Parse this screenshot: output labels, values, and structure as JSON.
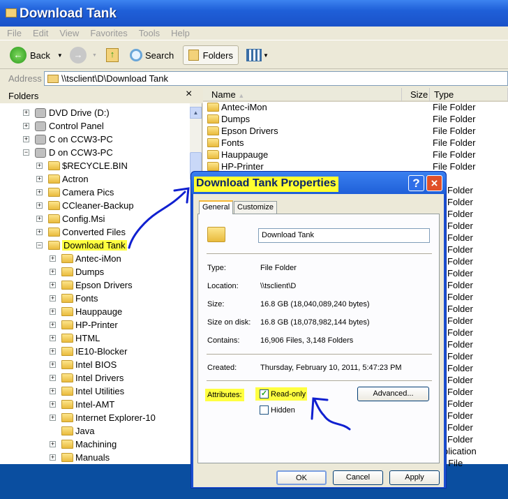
{
  "window": {
    "title": "Download Tank"
  },
  "menu": [
    "File",
    "Edit",
    "View",
    "Favorites",
    "Tools",
    "Help"
  ],
  "toolbar": {
    "back": "Back",
    "search": "Search",
    "folders": "Folders"
  },
  "address": {
    "label": "Address",
    "value": "\\\\tsclient\\D\\Download Tank"
  },
  "folders_pane": {
    "title": "Folders",
    "close": "×"
  },
  "tree": [
    {
      "label": "DVD Drive (D:)",
      "level": 0,
      "icon": "dvd-drive-icon",
      "exp": "+"
    },
    {
      "label": "Control Panel",
      "level": 0,
      "icon": "control-panel-icon",
      "exp": "+"
    },
    {
      "label": "C on CCW3-PC",
      "level": 0,
      "icon": "network-drive-icon",
      "exp": "+"
    },
    {
      "label": "D on CCW3-PC",
      "level": 0,
      "icon": "network-drive-icon",
      "exp": "−"
    },
    {
      "label": "$RECYCLE.BIN",
      "level": 1,
      "exp": "+"
    },
    {
      "label": "Actron",
      "level": 1,
      "exp": "+"
    },
    {
      "label": "Camera Pics",
      "level": 1,
      "exp": "+"
    },
    {
      "label": "CCleaner-Backup",
      "level": 1,
      "exp": "+"
    },
    {
      "label": "Config.Msi",
      "level": 1,
      "exp": "+"
    },
    {
      "label": "Converted Files",
      "level": 1,
      "exp": "+"
    },
    {
      "label": "Download Tank",
      "level": 1,
      "exp": "−",
      "selected": true
    },
    {
      "label": "Antec-iMon",
      "level": 2,
      "exp": "+"
    },
    {
      "label": "Dumps",
      "level": 2,
      "exp": "+"
    },
    {
      "label": "Epson Drivers",
      "level": 2,
      "exp": "+"
    },
    {
      "label": "Fonts",
      "level": 2,
      "exp": "+"
    },
    {
      "label": "Hauppauge",
      "level": 2,
      "exp": "+"
    },
    {
      "label": "HP-Printer",
      "level": 2,
      "exp": "+"
    },
    {
      "label": "HTML",
      "level": 2,
      "exp": "+"
    },
    {
      "label": "IE10-Blocker",
      "level": 2,
      "exp": "+"
    },
    {
      "label": "Intel BIOS",
      "level": 2,
      "exp": "+"
    },
    {
      "label": "Intel Drivers",
      "level": 2,
      "exp": "+"
    },
    {
      "label": "Intel Utilities",
      "level": 2,
      "exp": "+"
    },
    {
      "label": "Intel-AMT",
      "level": 2,
      "exp": "+"
    },
    {
      "label": "Internet Explorer-10",
      "level": 2,
      "exp": "+"
    },
    {
      "label": "Java",
      "level": 2,
      "exp": ""
    },
    {
      "label": "Machining",
      "level": 2,
      "exp": "+"
    },
    {
      "label": "Manuals",
      "level": 2,
      "exp": "+"
    }
  ],
  "list": {
    "columns": [
      "Name",
      "Size",
      "Type"
    ],
    "rows": [
      {
        "name": "Antec-iMon",
        "type": "File Folder"
      },
      {
        "name": "Dumps",
        "type": "File Folder"
      },
      {
        "name": "Epson Drivers",
        "type": "File Folder"
      },
      {
        "name": "Fonts",
        "type": "File Folder"
      },
      {
        "name": "Hauppauge",
        "type": "File Folder"
      },
      {
        "name": "HP-Printer",
        "type": "File Folder"
      }
    ],
    "type_column_visible": [
      "Folder",
      "Folder",
      "Folder",
      "Folder",
      "Folder",
      "Folder",
      "Folder",
      "Folder",
      "Folder",
      "Folder",
      "Folder",
      "Folder",
      "Folder",
      "Folder",
      "Folder",
      "Folder",
      "Folder",
      "Folder",
      "Folder",
      "Folder",
      "Folder",
      "Folder",
      "plication",
      "/ File"
    ]
  },
  "dialog": {
    "title": "Download Tank Properties",
    "help": "?",
    "close": "×",
    "tabs": [
      "General",
      "Customize"
    ],
    "name_value": "Download Tank",
    "props": [
      {
        "label": "Type:",
        "value": "File Folder"
      },
      {
        "label": "Location:",
        "value": "\\\\tsclient\\D"
      },
      {
        "label": "Size:",
        "value": "16.8 GB (18,040,089,240 bytes)"
      },
      {
        "label": "Size on disk:",
        "value": "16.8 GB (18,078,982,144 bytes)"
      },
      {
        "label": "Contains:",
        "value": "16,906 Files, 3,148 Folders"
      }
    ],
    "created": {
      "label": "Created:",
      "value": "Thursday, February 10, 2011, 5:47:23 PM"
    },
    "attributes": {
      "label": "Attributes:",
      "readonly": "Read-only",
      "readonly_checked": true,
      "hidden": "Hidden",
      "hidden_checked": false,
      "advanced": "Advanced..."
    },
    "buttons": {
      "ok": "OK",
      "cancel": "Cancel",
      "apply": "Apply"
    }
  },
  "colors": {
    "titlebar": "#1f5fd8",
    "highlight": "#ffff30",
    "annotation": "#1020d0"
  }
}
